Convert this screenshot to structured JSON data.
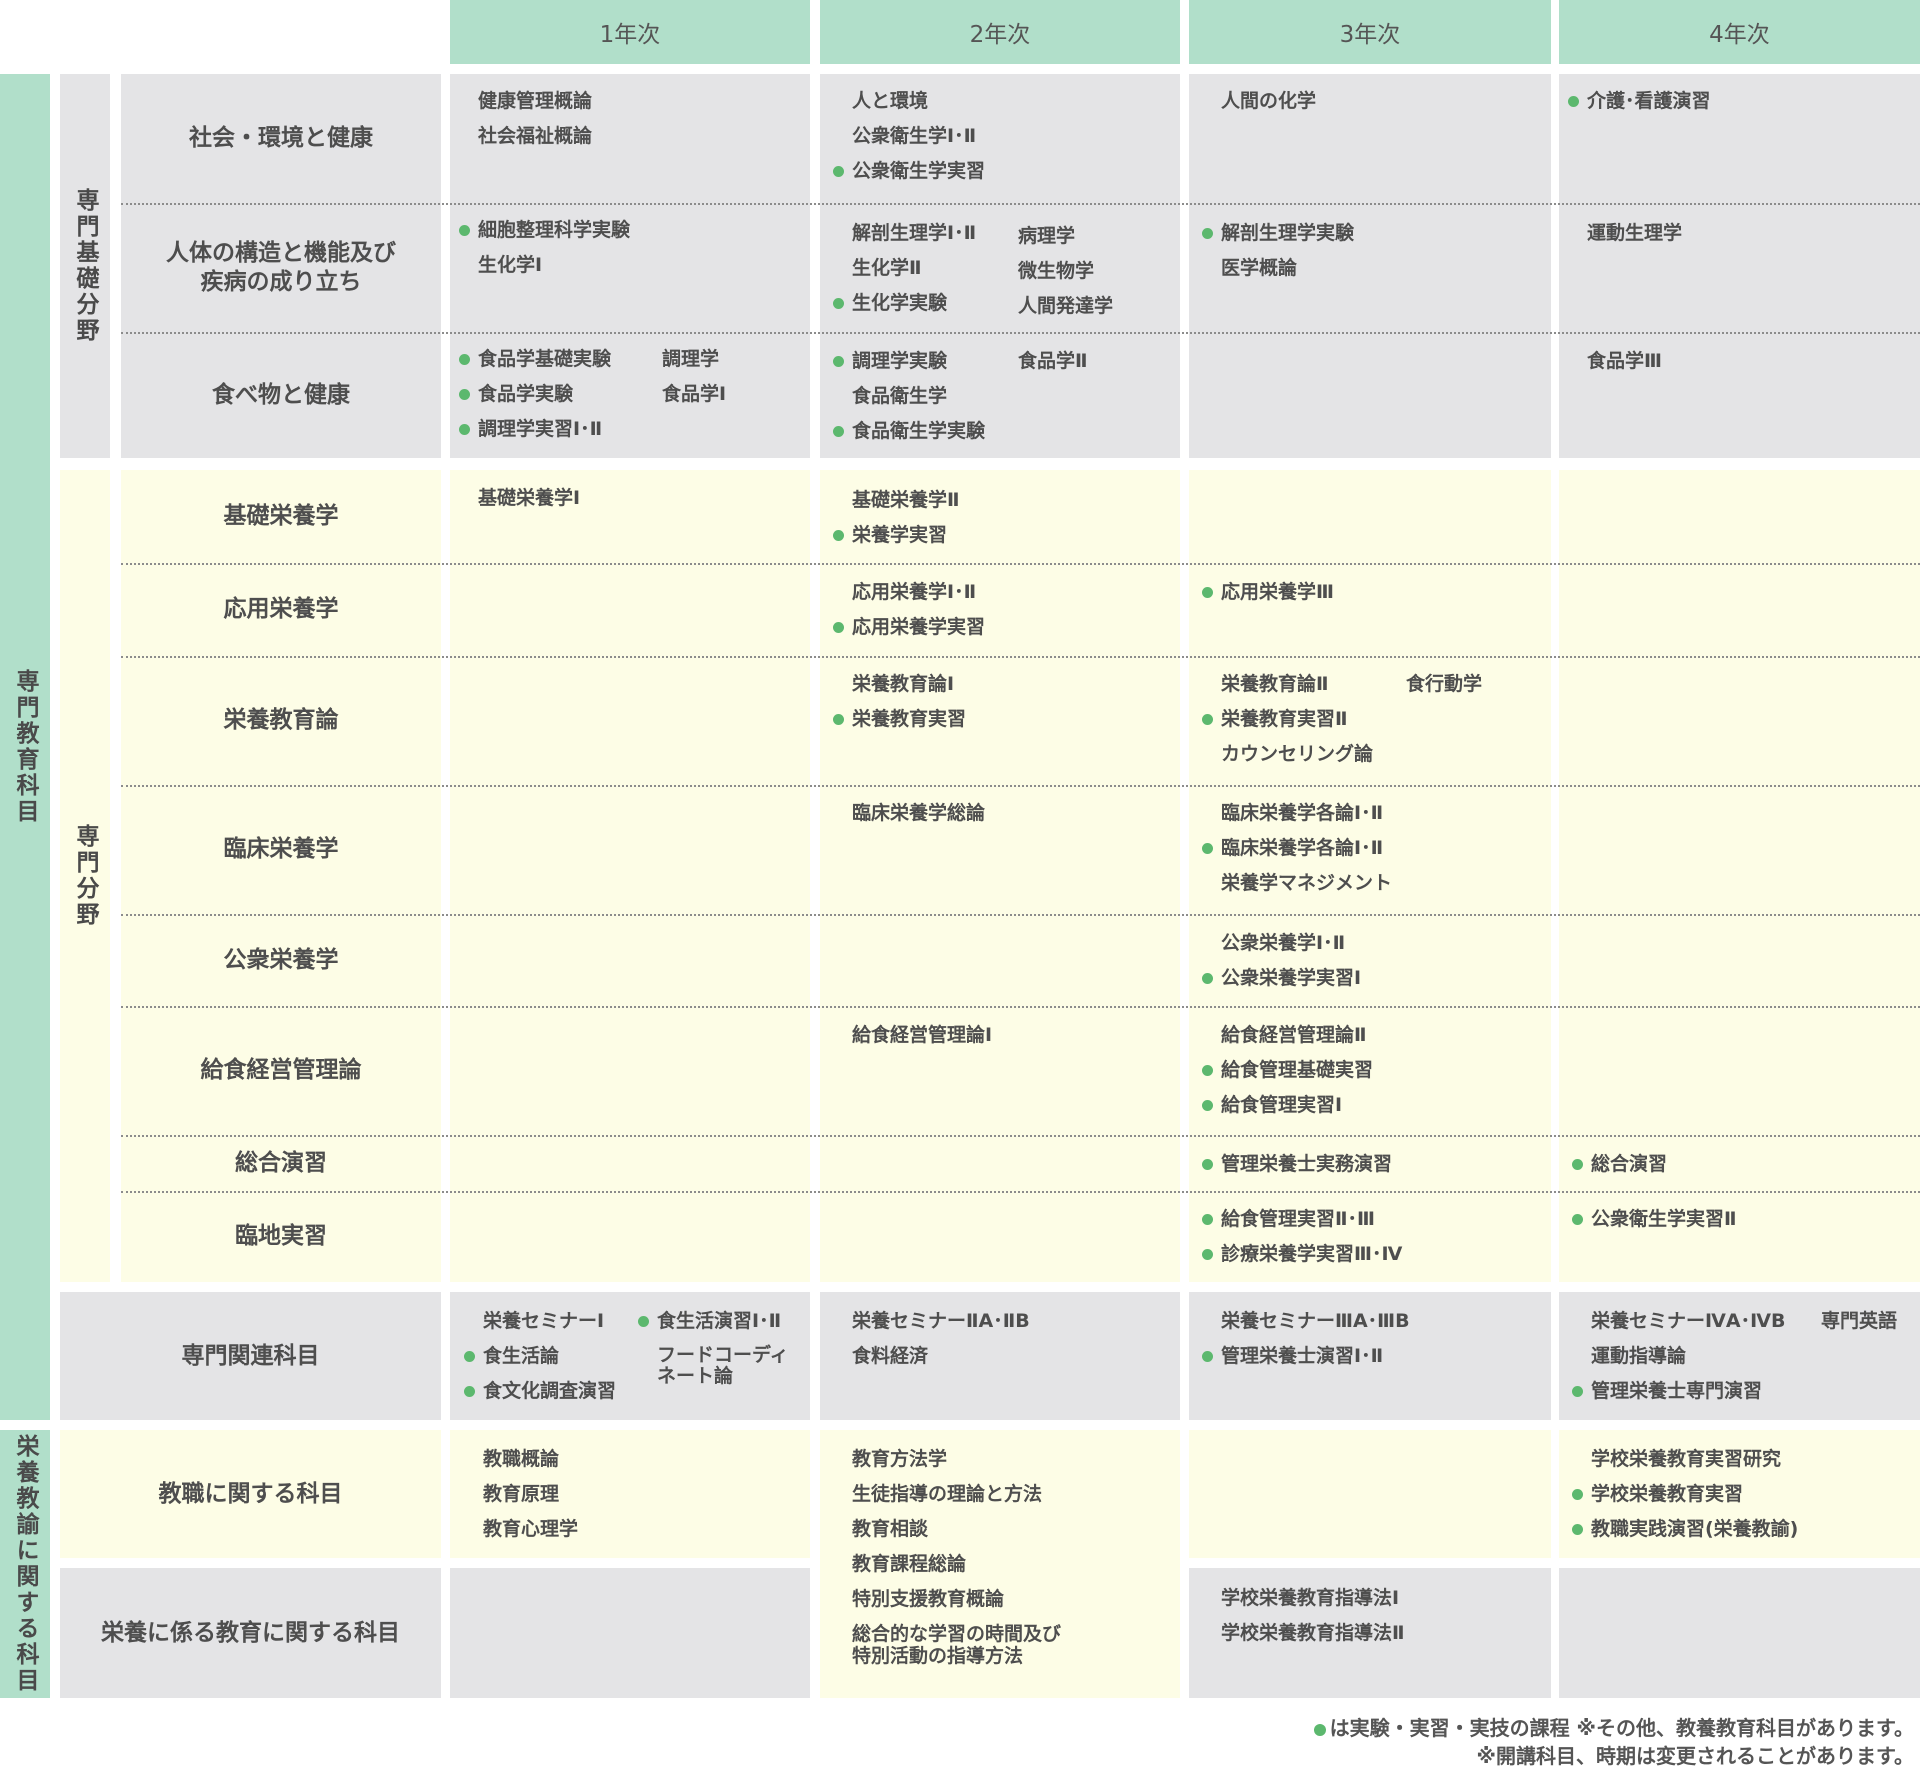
{
  "years": [
    "1年次",
    "2年次",
    "3年次",
    "4年次"
  ],
  "groups": {
    "senmon_kyoiku": "専門教育科目",
    "senmon_kiso": "専門基礎分野",
    "senmon_bunya": "専門分野",
    "eiyo_kyoyu": "栄養教諭に関する科目"
  },
  "categories": {
    "shakai": "社会・環境と健康",
    "jintai": "人体の構造と機能及び\n疾病の成り立ち",
    "tabemono": "食べ物と健康",
    "kiso_eiyo": "基礎栄養学",
    "oyo_eiyo": "応用栄養学",
    "eiyo_kyoiku": "栄養教育論",
    "rinsho": "臨床栄養学",
    "koshu": "公衆栄養学",
    "kyushoku": "給食経営管理論",
    "sogo": "総合演習",
    "rinchi": "臨地実習",
    "kanren": "専門関連科目",
    "kyoshoku": "教職に関する科目",
    "eiyo_kakaru": "栄養に係る教育に関する科目"
  },
  "courses": {
    "shakai_y1": [
      "健康管理概論",
      "社会福祉概論"
    ],
    "shakai_y2": [
      "人と環境",
      "公衆衛生学Ⅰ･Ⅱ",
      "公衆衛生学実習"
    ],
    "shakai_y3": [
      "人間の化学"
    ],
    "shakai_y4": [
      "介護･看護演習"
    ],
    "jintai_y1": [
      "細胞整理科学実験",
      "生化学Ⅰ"
    ],
    "jintai_y2a": [
      "解剖生理学Ⅰ･Ⅱ",
      "生化学Ⅱ",
      "生化学実験"
    ],
    "jintai_y2b": [
      "病理学",
      "微生物学",
      "人間発達学"
    ],
    "jintai_y3": [
      "解剖生理学実験",
      "医学概論"
    ],
    "jintai_y4": [
      "運動生理学"
    ],
    "tabemono_y1a": [
      "食品学基礎実験",
      "食品学実験",
      "調理学実習Ⅰ･Ⅱ"
    ],
    "tabemono_y1b": [
      "調理学",
      "食品学Ⅰ"
    ],
    "tabemono_y2a": [
      "調理学実験",
      "食品衛生学",
      "食品衛生学実験"
    ],
    "tabemono_y2b": [
      "食品学Ⅱ"
    ],
    "tabemono_y4": [
      "食品学Ⅲ"
    ],
    "kiso_y1": [
      "基礎栄養学Ⅰ"
    ],
    "kiso_y2": [
      "基礎栄養学Ⅱ",
      "栄養学実習"
    ],
    "oyo_y2": [
      "応用栄養学Ⅰ･Ⅱ",
      "応用栄養学実習"
    ],
    "oyo_y3": [
      "応用栄養学Ⅲ"
    ],
    "kyoiku_y2": [
      "栄養教育論Ⅰ",
      "栄養教育実習"
    ],
    "kyoiku_y3a": [
      "栄養教育論Ⅱ",
      "栄養教育実習Ⅱ",
      "カウンセリング論"
    ],
    "kyoiku_y3b": [
      "食行動学"
    ],
    "rinsho_y2": [
      "臨床栄養学総論"
    ],
    "rinsho_y3": [
      "臨床栄養学各論Ⅰ･Ⅱ",
      "臨床栄養学各論Ⅰ･Ⅱ",
      "栄養学マネジメント"
    ],
    "koshu_y3": [
      "公衆栄養学Ⅰ･Ⅱ",
      "公衆栄養学実習Ⅰ"
    ],
    "kyushoku_y2": [
      "給食経営管理論Ⅰ"
    ],
    "kyushoku_y3": [
      "給食経営管理論Ⅱ",
      "給食管理基礎実習",
      "給食管理実習Ⅰ"
    ],
    "sogo_y3": [
      "管理栄養士実務演習"
    ],
    "sogo_y4": [
      "総合演習"
    ],
    "rinchi_y3": [
      "給食管理実習Ⅱ･Ⅲ",
      "診療栄養学実習Ⅲ･Ⅳ"
    ],
    "rinchi_y4": [
      "公衆衛生学実習Ⅱ"
    ],
    "kanren_y1a": [
      "栄養セミナーⅠ",
      "食生活論",
      "食文化調査演習"
    ],
    "kanren_y1b": [
      "食生活演習Ⅰ･Ⅱ",
      "フードコーディ\nネート論"
    ],
    "kanren_y2": [
      "栄養セミナーⅡA･ⅡB",
      "食料経済"
    ],
    "kanren_y3": [
      "栄養セミナーⅢA･ⅢB",
      "管理栄養士演習Ⅰ･Ⅱ"
    ],
    "kanren_y4a": [
      "栄養セミナーⅣA･ⅣB",
      "運動指導論",
      "管理栄養士専門演習"
    ],
    "kanren_y4b": [
      "専門英語"
    ],
    "kyoshoku_y1": [
      "教職概論",
      "教育原理",
      "教育心理学"
    ],
    "kyoshoku_y2": [
      "教育方法学",
      "生徒指導の理論と方法",
      "教育相談",
      "教育課程総論",
      "特別支援教育概論",
      "総合的な学習の時間及び\n特別活動の指導方法"
    ],
    "kyoshoku_y4": [
      "学校栄養教育実習研究",
      "学校栄養教育実習",
      "教職実践演習(栄養教諭)"
    ],
    "kakaru_y3": [
      "学校栄養教育指導法Ⅰ",
      "学校栄養教育指導法Ⅱ"
    ]
  },
  "legend": {
    "line1": "は実験・実習・実技の課程 ※その他、教養教育科目があります。",
    "line2": "※開講科目、時期は変更されることがあります。"
  }
}
